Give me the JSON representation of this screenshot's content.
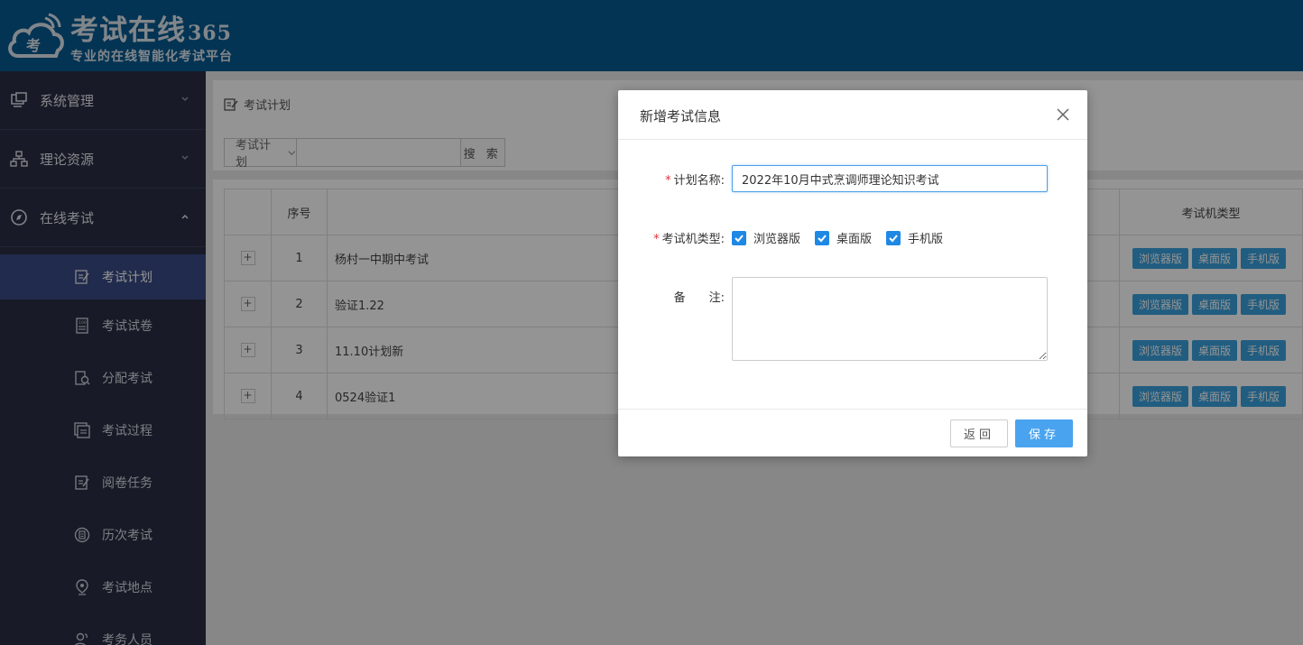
{
  "brand": {
    "logo_char": "考",
    "title": "考试在线",
    "title_num": "365",
    "subtitle": "专业的在线智能化考试平台"
  },
  "sidebar": {
    "groups": [
      {
        "label": "系统管理",
        "icon": "monitor-icon",
        "expanded": false
      },
      {
        "label": "理论资源",
        "icon": "sitemap-icon",
        "expanded": false
      },
      {
        "label": "在线考试",
        "icon": "compass-icon",
        "expanded": true
      }
    ],
    "items": [
      {
        "label": "考试计划",
        "icon": "edit-doc-icon",
        "active": true
      },
      {
        "label": "考试试卷",
        "icon": "paper-icon",
        "active": false
      },
      {
        "label": "分配考试",
        "icon": "assign-icon",
        "active": false
      },
      {
        "label": "考试过程",
        "icon": "process-icon",
        "active": false
      },
      {
        "label": "阅卷任务",
        "icon": "grading-icon",
        "active": false
      },
      {
        "label": "历次考试",
        "icon": "history-icon",
        "active": false
      },
      {
        "label": "考试地点",
        "icon": "location-icon",
        "active": false
      },
      {
        "label": "考务人员",
        "icon": "staff-icon",
        "active": false
      }
    ]
  },
  "main": {
    "breadcrumb": "考试计划",
    "search": {
      "select_value": "考试计划",
      "input_value": "",
      "button_label": "搜 索"
    },
    "table": {
      "headers": {
        "no": "序号",
        "name": "",
        "type": "考试机类型"
      },
      "rows": [
        {
          "no": "1",
          "name": "杨村一中期中考试",
          "tags": [
            "浏览器版",
            "桌面版",
            "手机版"
          ]
        },
        {
          "no": "2",
          "name": "验证1.22",
          "tags": [
            "浏览器版",
            "桌面版",
            "手机版"
          ]
        },
        {
          "no": "3",
          "name": "11.10计划新",
          "tags": [
            "浏览器版",
            "桌面版",
            "手机版"
          ]
        },
        {
          "no": "4",
          "name": "0524验证1",
          "tags": [
            "浏览器版",
            "桌面版",
            "手机版"
          ]
        }
      ]
    }
  },
  "modal": {
    "title": "新增考试信息",
    "plan_name_label": "计划名称:",
    "plan_name_value": "2022年10月中式烹调师理论知识考试",
    "machine_type_label": "考试机类型:",
    "machine_types": [
      {
        "label": "浏览器版",
        "checked": true
      },
      {
        "label": "桌面版",
        "checked": true
      },
      {
        "label": "手机版",
        "checked": true
      }
    ],
    "remark_label": "备　　注:",
    "remark_value": "",
    "back_button": "返回",
    "save_button": "保存"
  },
  "colors": {
    "header_bg": "#075a92",
    "sidebar_bg": "#2a2f44",
    "sidebar_active": "#3a4a86",
    "tag_blue": "#3aa0dc",
    "save_blue": "#4aa3ef",
    "checkbox_blue": "#1e88e5",
    "required_red": "#e0303a"
  }
}
